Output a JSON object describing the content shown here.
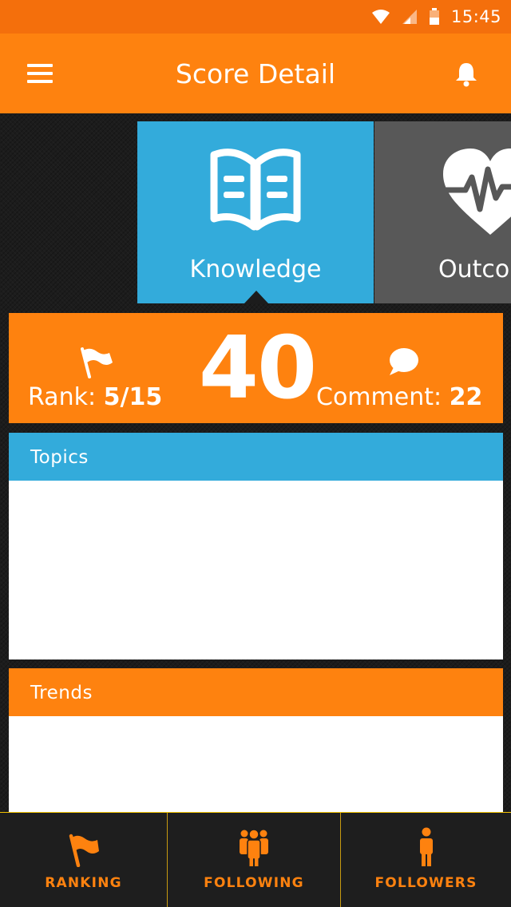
{
  "status_bar": {
    "time": "15:45",
    "icons": [
      "wifi-icon",
      "signal-icon",
      "battery-icon"
    ]
  },
  "app_bar": {
    "title": "Score Detail",
    "left_icon": "menu-icon",
    "right_icon": "bell-icon"
  },
  "categories": [
    {
      "label": "Knowledge",
      "icon": "book-icon",
      "color": "#33abdb",
      "selected": true
    },
    {
      "label": "Outcome",
      "icon": "heart-pulse-icon",
      "color": "#585858",
      "selected": false
    }
  ],
  "score": {
    "value": "40",
    "rank_label": "Rank:",
    "rank_value": "5/15",
    "comment_label": "Comment:",
    "comment_value": "22"
  },
  "sections": {
    "topics": {
      "title": "Topics",
      "color": "#33abdb"
    },
    "trends": {
      "title": "Trends",
      "color": "#fe820f"
    }
  },
  "bottom_nav": [
    {
      "label": "RANKING",
      "icon": "flag-icon"
    },
    {
      "label": "FOLLOWING",
      "icon": "group-icon"
    },
    {
      "label": "FOLLOWERS",
      "icon": "person-icon"
    }
  ],
  "colors": {
    "accent": "#fe820f",
    "status_bar": "#f46f0c",
    "blue": "#33abdb",
    "background": "#1c1c1c"
  }
}
